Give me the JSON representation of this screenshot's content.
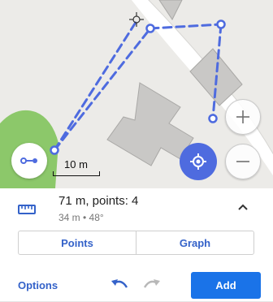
{
  "map": {
    "scale_label": "10 m"
  },
  "measurement": {
    "title": "71 m, points: 4",
    "subtitle": "34 m • 48°"
  },
  "tabs": [
    {
      "label": "Points"
    },
    {
      "label": "Graph"
    }
  ],
  "toolbar": {
    "options_label": "Options",
    "add_label": "Add"
  },
  "colors": {
    "route": "#4e6bdf",
    "accent": "#3462c9",
    "add_button": "#1a73e8",
    "park": "#8cc86a",
    "building": "#c9c8c6"
  },
  "icons": {
    "ruler": "ruler-icon",
    "route_mode": "route-mode-icon",
    "location": "my-location-icon",
    "zoom_in": "zoom-in-icon",
    "zoom_out": "zoom-out-icon",
    "collapse": "chevron-up-icon",
    "undo": "undo-icon",
    "redo": "redo-icon"
  }
}
